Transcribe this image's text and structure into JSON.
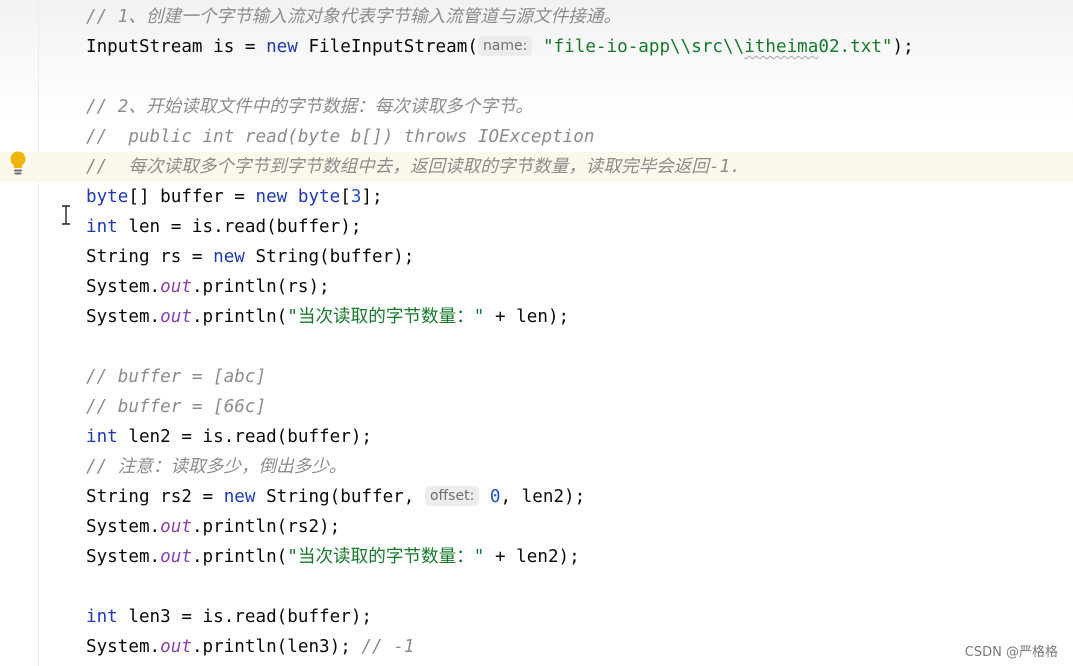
{
  "editor": {
    "lines": {
      "l1": {
        "comment": "// 1、创建一个字节输入流对象代表字节输入流管道与源文件接通。"
      },
      "l2": {
        "t1": "InputStream is = ",
        "kw": "new",
        "t2": " FileInputStream(",
        "hint": "name:",
        "s1": "\"file-io-app\\\\src\\\\",
        "s2": "itheima",
        "s3": "02.txt\"",
        "t3": ");"
      },
      "l4": {
        "comment": "// 2、开始读取文件中的字节数据：每次读取多个字节。"
      },
      "l5": {
        "comment": "//  public int read(byte b[]) throws IOException"
      },
      "l6": {
        "comment": "//  每次读取多个字节到字节数组中去，返回读取的字节数量，读取完毕会返回-1."
      },
      "l7": {
        "kw1": "byte",
        "t1": "[] buffer = ",
        "kw2": "new",
        "kw3": " byte",
        "t2": "[",
        "num": "3",
        "t3": "];"
      },
      "l8": {
        "kw": "int",
        "t1": " len = is.read(buffer);"
      },
      "l9": {
        "t1": "String rs = ",
        "kw": "new",
        "t2": " String(buffer);"
      },
      "l10": {
        "t1": "System.",
        "field": "out",
        "t2": ".println(rs);"
      },
      "l11": {
        "t1": "System.",
        "field": "out",
        "t2": ".println(",
        "str": "\"当次读取的字节数量：\"",
        "t3": " + len);"
      },
      "l13": {
        "comment": "// buffer = [abc]"
      },
      "l14": {
        "comment": "// buffer = [66c]"
      },
      "l15": {
        "kw": "int",
        "t1": " len2 = is.read(buffer);"
      },
      "l16": {
        "comment": "// 注意：读取多少，倒出多少。"
      },
      "l17": {
        "t1": "String rs2 = ",
        "kw": "new",
        "t2": " String(buffer, ",
        "hint": "offset:",
        "num": "0",
        "t3": ", len2);"
      },
      "l18": {
        "t1": "System.",
        "field": "out",
        "t2": ".println(rs2);"
      },
      "l19": {
        "t1": "System.",
        "field": "out",
        "t2": ".println(",
        "str": "\"当次读取的字节数量：\"",
        "t3": " + len2);"
      },
      "l21": {
        "kw": "int",
        "t1": " len3 = is.read(buffer);"
      },
      "l22": {
        "t1": "System.",
        "field": "out",
        "t2": ".println(len3); ",
        "comment": "// -1"
      }
    }
  },
  "icons": {
    "intention": "lightbulb-icon",
    "cursor": "text-cursor-icon"
  },
  "colors": {
    "keyword": "#1e3ab0",
    "string": "#177a2a",
    "number": "#1c55c9",
    "field": "#8b3fb0",
    "comment": "#8c8c8c",
    "highlight_line": "#fcf8ec",
    "bulb": "#f2b20f"
  },
  "watermark": "CSDN @严格格"
}
